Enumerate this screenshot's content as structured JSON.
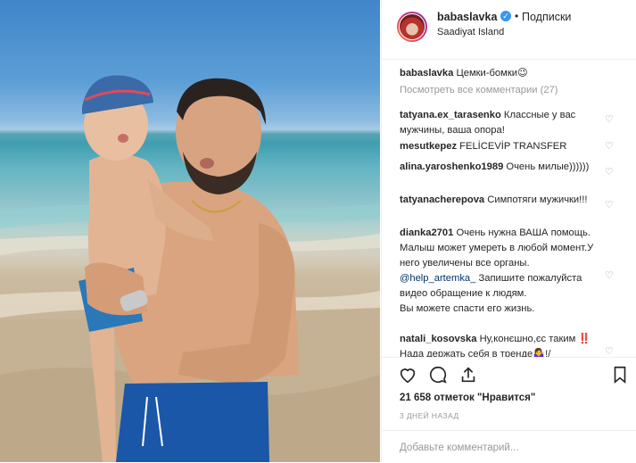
{
  "post": {
    "username": "babaslavka",
    "verified_icon": "verified-badge-icon",
    "separator": "•",
    "follow_label": "Подписки",
    "location": "Saadiyat Island"
  },
  "caption": {
    "username": "babaslavka",
    "text": "Цемки-бомки😉"
  },
  "view_all_comments": "Посмотреть все комментарии (27)",
  "comments": [
    {
      "username": "tatyana.ex_tarasenko",
      "text": "Классные у вас мужчины, ваша опора!"
    },
    {
      "username": "mesutkepez",
      "text": "FELİCEVİP TRANSFER"
    },
    {
      "username": "alina.yaroshenko1989",
      "text": "Очень милые))))))"
    },
    {
      "username": "tatyanacherepova",
      "text": "Симпотяги мужички!!!"
    },
    {
      "username": "dianka2701",
      "text": "Очень нужна ВАША помощь. Малыш может умереть в любой момент.У него увеличены все органы.",
      "mention": "@help_artemka_",
      "text2": "Запишите пожалуйста видео обращение к людям.",
      "text3": "Вы можете спасти его жизнь."
    },
    {
      "username": "natali_kosovska",
      "text": "Ну,конєшно,єс таким ‼️Нада держать себя в тренде🤷‍♀️!/"
    }
  ],
  "actions": {
    "like_icon": "heart-icon",
    "comment_icon": "comment-icon",
    "share_icon": "share-icon",
    "save_icon": "bookmark-icon"
  },
  "likes": "21 658 отметок \"Нравится\"",
  "timestamp": "3 ДНЕЙ НАЗАД",
  "add_comment": {
    "placeholder": "Добавьте комментарий..."
  },
  "colors": {
    "link": "#003569",
    "verified": "#3897f0",
    "muted": "#999999",
    "text": "#262626"
  }
}
